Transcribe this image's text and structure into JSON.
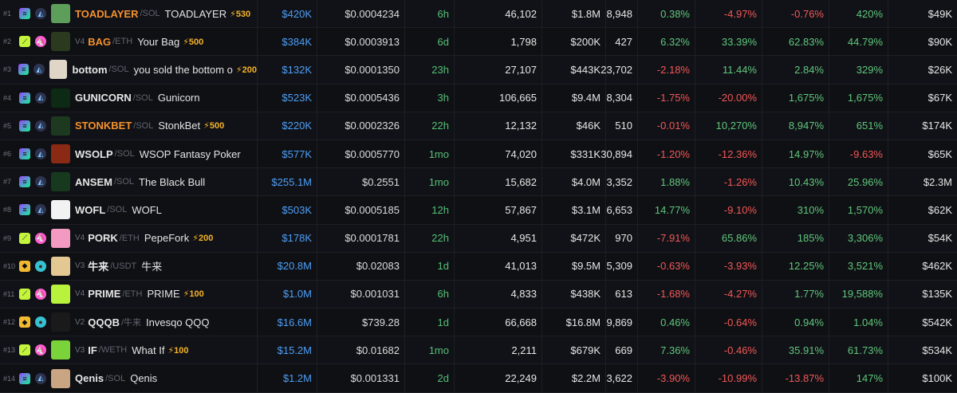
{
  "colors": {
    "positive": "#5fc77c",
    "negative": "#f25757",
    "accent": "#4d9ff7",
    "boost": "#f5b328",
    "orange": "#f5922e"
  },
  "rows": [
    {
      "rank": "#1",
      "chain": "solana",
      "dex": "raydium",
      "version": "",
      "symbol": "TOADLAYER",
      "symbol_orange": true,
      "quote": "/SOL",
      "name": "TOADLAYER",
      "boost": "⚡530",
      "avatar": "#5c9e5a",
      "price": "$420K",
      "token_price": "$0.0004234",
      "age": "6h",
      "txns": "46,102",
      "volume": "$1.8M",
      "makers": "8,948",
      "m5": "0.38%",
      "h1": "-4.97%",
      "h6": "-0.76%",
      "h24": "420%",
      "mcap": "$49K"
    },
    {
      "rank": "#2",
      "chain": "ethereum",
      "dex": "uniswap",
      "version": "V4",
      "symbol": "BAG",
      "symbol_orange": true,
      "quote": "/ETH",
      "name": "Your Bag",
      "boost": "⚡500",
      "avatar": "#2b3a1f",
      "price": "$384K",
      "token_price": "$0.0003913",
      "age": "6d",
      "txns": "1,798",
      "volume": "$200K",
      "makers": "427",
      "m5": "6.32%",
      "h1": "33.39%",
      "h6": "62.83%",
      "h24": "44.79%",
      "mcap": "$90K"
    },
    {
      "rank": "#3",
      "chain": "solana",
      "dex": "raydium",
      "version": "",
      "symbol": "bottom",
      "symbol_orange": false,
      "quote": "/SOL",
      "name": "you sold the bottom o",
      "boost": "⚡200",
      "avatar": "#e0d6c8",
      "price": "$132K",
      "token_price": "$0.0001350",
      "age": "23h",
      "txns": "27,107",
      "volume": "$443K",
      "makers": "23,702",
      "m5": "-2.18%",
      "h1": "11.44%",
      "h6": "2.84%",
      "h24": "329%",
      "mcap": "$26K"
    },
    {
      "rank": "#4",
      "chain": "solana",
      "dex": "raydium",
      "version": "",
      "symbol": "GUNICORN",
      "symbol_orange": false,
      "quote": "/SOL",
      "name": "Gunicorn",
      "boost": "",
      "avatar": "#0c2a14",
      "price": "$523K",
      "token_price": "$0.0005436",
      "age": "3h",
      "txns": "106,665",
      "volume": "$9.4M",
      "makers": "8,304",
      "m5": "-1.75%",
      "h1": "-20.00%",
      "h6": "1,675%",
      "h24": "1,675%",
      "mcap": "$67K"
    },
    {
      "rank": "#5",
      "chain": "solana",
      "dex": "raydium",
      "version": "",
      "symbol": "STONKBET",
      "symbol_orange": true,
      "quote": "/SOL",
      "name": "StonkBet",
      "boost": "⚡500",
      "avatar": "#1d3a20",
      "price": "$220K",
      "token_price": "$0.0002326",
      "age": "22h",
      "txns": "12,132",
      "volume": "$46K",
      "makers": "510",
      "m5": "-0.01%",
      "h1": "10,270%",
      "h6": "8,947%",
      "h24": "651%",
      "mcap": "$174K"
    },
    {
      "rank": "#6",
      "chain": "solana",
      "dex": "raydium",
      "version": "",
      "symbol": "WSOLP",
      "symbol_orange": false,
      "quote": "/SOL",
      "name": "WSOP Fantasy Poker",
      "boost": "",
      "avatar": "#8a2a14",
      "price": "$577K",
      "token_price": "$0.0005770",
      "age": "1mo",
      "txns": "74,020",
      "volume": "$331K",
      "makers": "30,894",
      "m5": "-1.20%",
      "h1": "-12.36%",
      "h6": "14.97%",
      "h24": "-9.63%",
      "mcap": "$65K"
    },
    {
      "rank": "#7",
      "chain": "solana",
      "dex": "raydium",
      "version": "",
      "symbol": "ANSEM",
      "symbol_orange": false,
      "quote": "/SOL",
      "name": "The Black Bull",
      "boost": "",
      "avatar": "#173a1f",
      "price": "$255.1M",
      "token_price": "$0.2551",
      "age": "1mo",
      "txns": "15,682",
      "volume": "$4.0M",
      "makers": "3,352",
      "m5": "1.88%",
      "h1": "-1.26%",
      "h6": "10.43%",
      "h24": "25.96%",
      "mcap": "$2.3M"
    },
    {
      "rank": "#8",
      "chain": "solana",
      "dex": "raydium",
      "version": "",
      "symbol": "WOFL",
      "symbol_orange": false,
      "quote": "/SOL",
      "name": "WOFL",
      "boost": "",
      "avatar": "#f2f2f2",
      "price": "$503K",
      "token_price": "$0.0005185",
      "age": "12h",
      "txns": "57,867",
      "volume": "$3.1M",
      "makers": "6,653",
      "m5": "14.77%",
      "h1": "-9.10%",
      "h6": "310%",
      "h24": "1,570%",
      "mcap": "$62K"
    },
    {
      "rank": "#9",
      "chain": "ethereum",
      "dex": "uniswap",
      "version": "V4",
      "symbol": "PORK",
      "symbol_orange": false,
      "quote": "/ETH",
      "name": "PepeFork",
      "boost": "⚡200",
      "avatar": "#f29ac1",
      "price": "$178K",
      "token_price": "$0.0001781",
      "age": "22h",
      "txns": "4,951",
      "volume": "$472K",
      "makers": "970",
      "m5": "-7.91%",
      "h1": "65.86%",
      "h6": "185%",
      "h24": "3,306%",
      "mcap": "$54K"
    },
    {
      "rank": "#10",
      "chain": "bsc",
      "dex": "pancakeswap",
      "version": "V3",
      "symbol": "牛来",
      "symbol_orange": false,
      "quote": "/USDT",
      "name": "牛来",
      "boost": "",
      "avatar": "#e3c893",
      "price": "$20.8M",
      "token_price": "$0.02083",
      "age": "1d",
      "txns": "41,013",
      "volume": "$9.5M",
      "makers": "5,309",
      "m5": "-0.63%",
      "h1": "-3.93%",
      "h6": "12.25%",
      "h24": "3,521%",
      "mcap": "$462K"
    },
    {
      "rank": "#11",
      "chain": "ethereum",
      "dex": "uniswap",
      "version": "V4",
      "symbol": "PRIME",
      "symbol_orange": false,
      "quote": "/ETH",
      "name": "PRIME",
      "boost": "⚡100",
      "avatar": "#b8f23c",
      "price": "$1.0M",
      "token_price": "$0.001031",
      "age": "6h",
      "txns": "4,833",
      "volume": "$438K",
      "makers": "613",
      "m5": "-1.68%",
      "h1": "-4.27%",
      "h6": "1.77%",
      "h24": "19,588%",
      "mcap": "$135K"
    },
    {
      "rank": "#12",
      "chain": "bsc",
      "dex": "pancakeswap",
      "version": "V2",
      "symbol": "QQQB",
      "symbol_orange": false,
      "quote": "/牛来",
      "name": "Invesqo QQQ",
      "boost": "",
      "avatar": "#1a1a1a",
      "price": "$16.6M",
      "token_price": "$739.28",
      "age": "1d",
      "txns": "66,668",
      "volume": "$16.8M",
      "makers": "9,869",
      "m5": "0.46%",
      "h1": "-0.64%",
      "h6": "0.94%",
      "h24": "1.04%",
      "mcap": "$542K"
    },
    {
      "rank": "#13",
      "chain": "ethereum",
      "dex": "uniswap",
      "version": "V3",
      "symbol": "IF",
      "symbol_orange": false,
      "quote": "/WETH",
      "name": "What If",
      "boost": "⚡100",
      "avatar": "#7ad33a",
      "price": "$15.2M",
      "token_price": "$0.01682",
      "age": "1mo",
      "txns": "2,211",
      "volume": "$679K",
      "makers": "669",
      "m5": "7.36%",
      "h1": "-0.46%",
      "h6": "35.91%",
      "h24": "61.73%",
      "mcap": "$534K"
    },
    {
      "rank": "#14",
      "chain": "solana",
      "dex": "raydium",
      "version": "",
      "symbol": "Qenis",
      "symbol_orange": false,
      "quote": "/SOL",
      "name": "Qenis",
      "boost": "",
      "avatar": "#c9a583",
      "price": "$1.2M",
      "token_price": "$0.001331",
      "age": "2d",
      "txns": "22,249",
      "volume": "$2.2M",
      "makers": "3,622",
      "m5": "-3.90%",
      "h1": "-10.99%",
      "h6": "-13.87%",
      "h24": "147%",
      "mcap": "$100K"
    }
  ]
}
